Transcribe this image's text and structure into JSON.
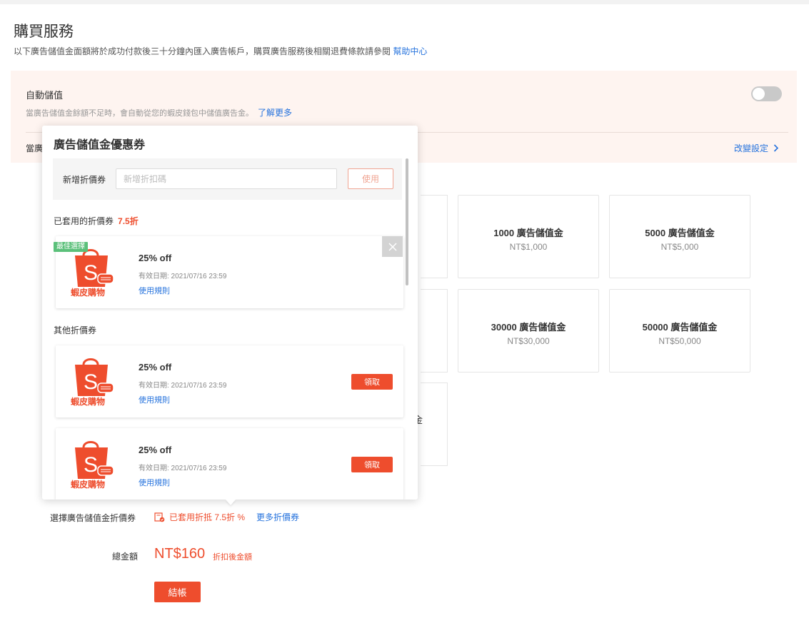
{
  "page": {
    "title": "購買服務",
    "subtitle": "以下廣告儲值金面額將於成功付款後三十分鐘內匯入廣告帳戶，購買廣告服務後相關退費條款請參閱",
    "help_link": "幫助中心"
  },
  "auto_topup": {
    "title": "自動儲值",
    "description": "當廣告儲值金餘額不足時，會自動從您的蝦皮錢包中儲值廣告金。",
    "learn_more": "了解更多",
    "enabled": false,
    "row2_label_partial": "當廣",
    "change_settings": "改變設定"
  },
  "packages": [
    {
      "amount": "1000 廣告儲值金",
      "price": "NT$1,000"
    },
    {
      "amount": "5000 廣告儲值金",
      "price": "NT$5,000"
    },
    {
      "amount": "30000 廣告儲值金",
      "price": "NT$30,000"
    },
    {
      "amount": "50000 廣告儲值金",
      "price": "NT$50,000"
    }
  ],
  "partial_card_glyph": "金",
  "voucher_select": {
    "label": "選擇廣告儲值金折價券",
    "applied_text": "已套用折抵 7.5折 %",
    "more_link": "更多折價券"
  },
  "total": {
    "label": "總金額",
    "value": "NT$160",
    "note": "折扣後金額"
  },
  "checkout_label": "結帳",
  "popover": {
    "title": "廣告儲值金優惠券",
    "add_label": "新增折價券",
    "add_placeholder": "新增折扣碼",
    "use_button": "使用",
    "applied_section_label": "已套用的折價券",
    "applied_discount": "7.5折",
    "other_section_label": "其他折價券",
    "applied_coupon": {
      "tag": "最佳選擇",
      "name": "25% off",
      "expiry": "有效日期: 2021/07/16 23:59",
      "rule": "使用規則",
      "logo_text": "蝦皮購物"
    },
    "other_coupons": [
      {
        "name": "25% off",
        "expiry": "有效日期: 2021/07/16 23:59",
        "rule": "使用規則",
        "claim": "領取",
        "logo_text": "蝦皮購物"
      },
      {
        "name": "25% off",
        "expiry": "有效日期: 2021/07/16 23:59",
        "rule": "使用規則",
        "claim": "領取",
        "logo_text": "蝦皮購物"
      }
    ]
  },
  "colors": {
    "brand": "#ee4d2d",
    "link": "#2673dd",
    "best_tag": "#5bc07a",
    "auto_bg": "#fef4f0"
  }
}
